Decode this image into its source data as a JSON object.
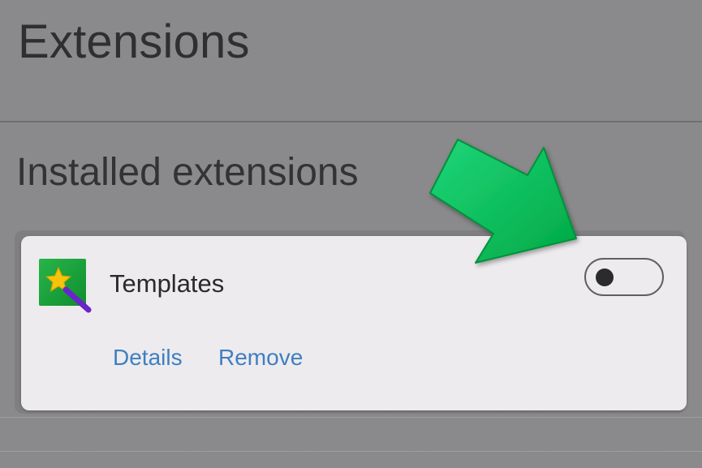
{
  "header": {
    "title": "Extensions"
  },
  "section": {
    "title": "Installed extensions"
  },
  "extension": {
    "name": "Templates",
    "icon": "magic-wand-icon",
    "enabled": false,
    "links": {
      "details": "Details",
      "remove": "Remove"
    }
  },
  "annotation": {
    "icon": "pointer-arrow-icon",
    "color": "#00b850"
  },
  "colors": {
    "background": "#8a898b",
    "card": "#edebee",
    "link": "#3f7fc0",
    "icon_green": "#19a33a",
    "icon_star": "#f6c40a",
    "icon_wand": "#6a24c9"
  }
}
